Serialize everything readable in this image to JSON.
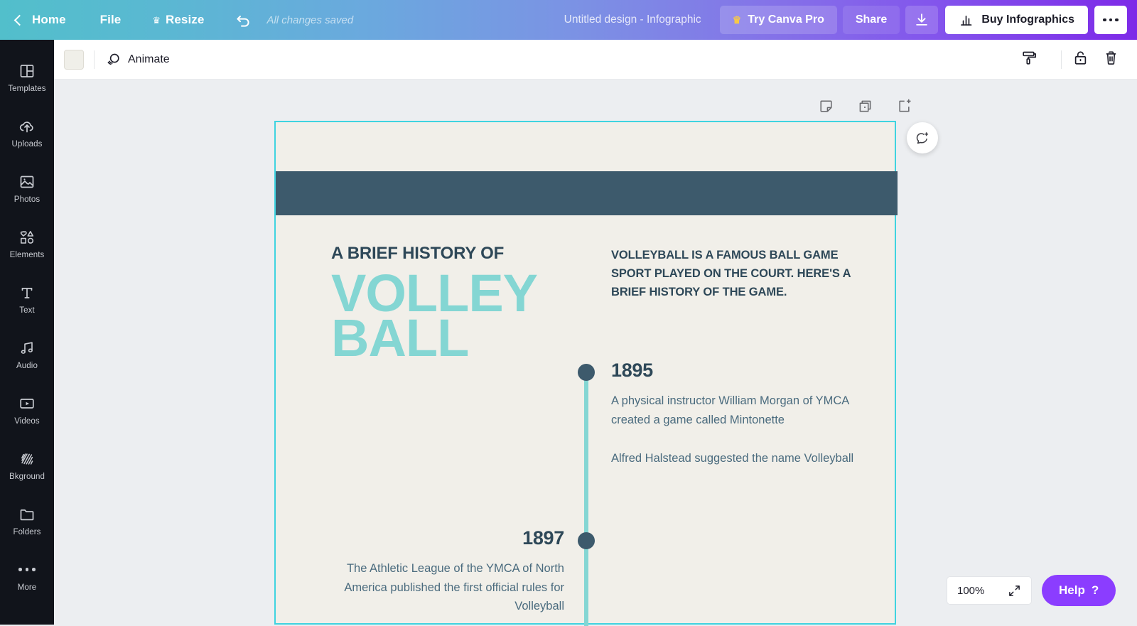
{
  "header": {
    "back_label": "Home",
    "file_label": "File",
    "resize_label": "Resize",
    "resize_icon": "crown-icon",
    "undo_icon": "undo-arrow-icon",
    "save_status": "All changes saved",
    "doc_title": "Untitled design - Infographic",
    "pro_label": "Try Canva Pro",
    "pro_icon": "crown-icon",
    "share_label": "Share",
    "download_icon": "download-icon",
    "buy_label": "Buy Infographics",
    "buy_icon": "bar-chart-icon",
    "more_icon": "ellipsis-icon",
    "gradient_start": "#52bfcb",
    "gradient_end": "#7d2ae8"
  },
  "sidebar": {
    "items": [
      {
        "label": "Templates",
        "icon": "templates-icon"
      },
      {
        "label": "Uploads",
        "icon": "upload-cloud-icon"
      },
      {
        "label": "Photos",
        "icon": "photo-icon"
      },
      {
        "label": "Elements",
        "icon": "shapes-icon"
      },
      {
        "label": "Text",
        "icon": "text-t-icon"
      },
      {
        "label": "Audio",
        "icon": "music-note-icon"
      },
      {
        "label": "Videos",
        "icon": "video-play-icon"
      },
      {
        "label": "Bkground",
        "icon": "hatch-pattern-icon"
      },
      {
        "label": "Folders",
        "icon": "folder-icon"
      },
      {
        "label": "More",
        "icon": "ellipsis-icon"
      }
    ]
  },
  "toolbar": {
    "swatch_color": "#f0efe9",
    "animate_label": "Animate",
    "animate_icon": "circles-icon",
    "copy_style_icon": "paint-roller-icon",
    "lock_icon": "unlock-padlock-icon",
    "delete_icon": "trash-icon"
  },
  "page_tools": {
    "notes_icon": "sticky-note-icon",
    "duplicate_icon": "duplicate-page-icon",
    "add_page_icon": "add-page-icon",
    "comment_icon": "add-comment-icon"
  },
  "canvas": {
    "background": "#f1efe9",
    "band_color": "#3d5a6c",
    "selection_color": "#3fd3e0",
    "accent_teal": "#84d6d3",
    "heading_small": "A BRIEF HISTORY OF",
    "heading_line1": "VOLLEY",
    "heading_line2": "BALL",
    "intro": "VOLLEYBALL IS A FAMOUS BALL GAME SPORT PLAYED ON THE COURT. HERE'S A BRIEF HISTORY OF THE GAME.",
    "events": [
      {
        "year": "1895",
        "paragraphs": [
          "A physical instructor William Morgan of YMCA created a game called Mintonette",
          "Alfred Halstead suggested the name Volleyball"
        ]
      },
      {
        "year": "1897",
        "paragraphs": [
          "The Athletic League of the YMCA of North America published the first official rules for Volleyball"
        ]
      }
    ]
  },
  "footer": {
    "zoom_level": "100%",
    "fit_icon": "expand-arrows-icon",
    "help_label": "Help",
    "help_mark": "?"
  }
}
